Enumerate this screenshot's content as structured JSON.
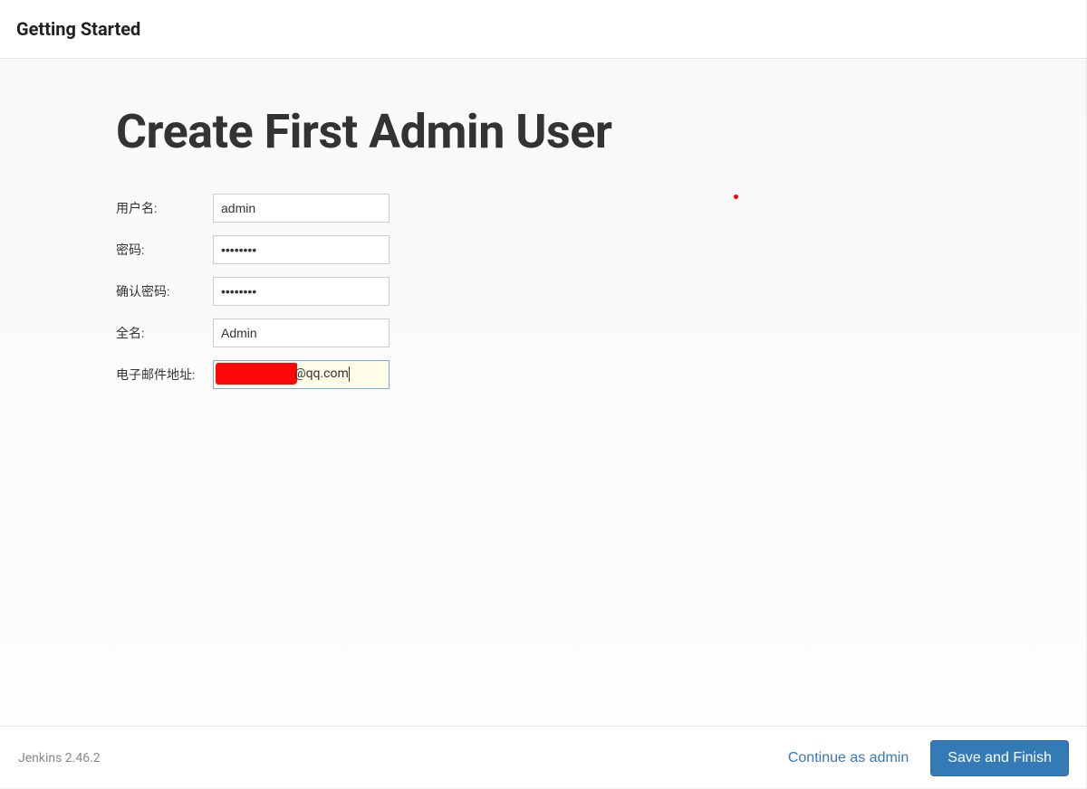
{
  "header": {
    "title": "Getting Started"
  },
  "main": {
    "heading": "Create First Admin User"
  },
  "form": {
    "username": {
      "label": "用户名:",
      "value": "admin"
    },
    "password": {
      "label": "密码:",
      "value": "••••••••"
    },
    "confirm_password": {
      "label": "确认密码:",
      "value": "••••••••"
    },
    "full_name": {
      "label": "全名:",
      "value": "Admin"
    },
    "email": {
      "label": "电子邮件地址:",
      "value_suffix": "@qq.com"
    }
  },
  "footer": {
    "version": "Jenkins 2.46.2",
    "continue_label": "Continue as admin",
    "save_label": "Save and Finish"
  }
}
